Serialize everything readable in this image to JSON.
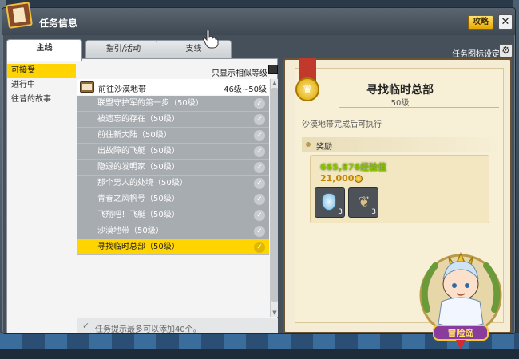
{
  "window": {
    "title": "任务信息",
    "guide_label": "攻略",
    "close_label": "✕"
  },
  "tabs": [
    {
      "label": "主线",
      "active": true
    },
    {
      "label": "指引/活动",
      "active": false
    },
    {
      "label": "支线",
      "active": false
    }
  ],
  "icon_settings_label": "任务图标设定",
  "gear_icon": "⚙",
  "categories": [
    {
      "label": "可接受",
      "active": true
    },
    {
      "label": "进行中",
      "active": false
    },
    {
      "label": "往昔的故事",
      "active": false
    }
  ],
  "similar_level_label": "只显示相似等级",
  "region": {
    "name": "前往沙漠地带",
    "level_range": "46级~50级"
  },
  "quests": [
    {
      "name": "联盟守护军的第一步（50级）",
      "selected": false
    },
    {
      "name": "被遗忘的存在（50级）",
      "selected": false
    },
    {
      "name": "前往新大陆（50级）",
      "selected": false
    },
    {
      "name": "出故障的飞艇（50级）",
      "selected": false
    },
    {
      "name": "隐退的发明家（50级）",
      "selected": false
    },
    {
      "name": "那个男人的处境（50级）",
      "selected": false
    },
    {
      "name": "青春之风帆号（50级）",
      "selected": false
    },
    {
      "name": "飞翔吧！飞艇（50级）",
      "selected": false
    },
    {
      "name": "沙漠地带（50级）",
      "selected": false
    },
    {
      "name": "寻找临时总部（50级）",
      "selected": true
    }
  ],
  "footer_text": "任务提示最多可以添加40个。",
  "detail": {
    "title": "寻找临时总部",
    "level": "50级",
    "condition": "沙漠地带完成后可执行",
    "reward_label": "奖励",
    "exp": "665,876经验值",
    "meso": "21,000",
    "items": [
      {
        "icon": "potion-icon",
        "count": "3"
      },
      {
        "icon": "leaf-icon",
        "count": "3"
      }
    ]
  },
  "mascot_text": "冒险岛"
}
